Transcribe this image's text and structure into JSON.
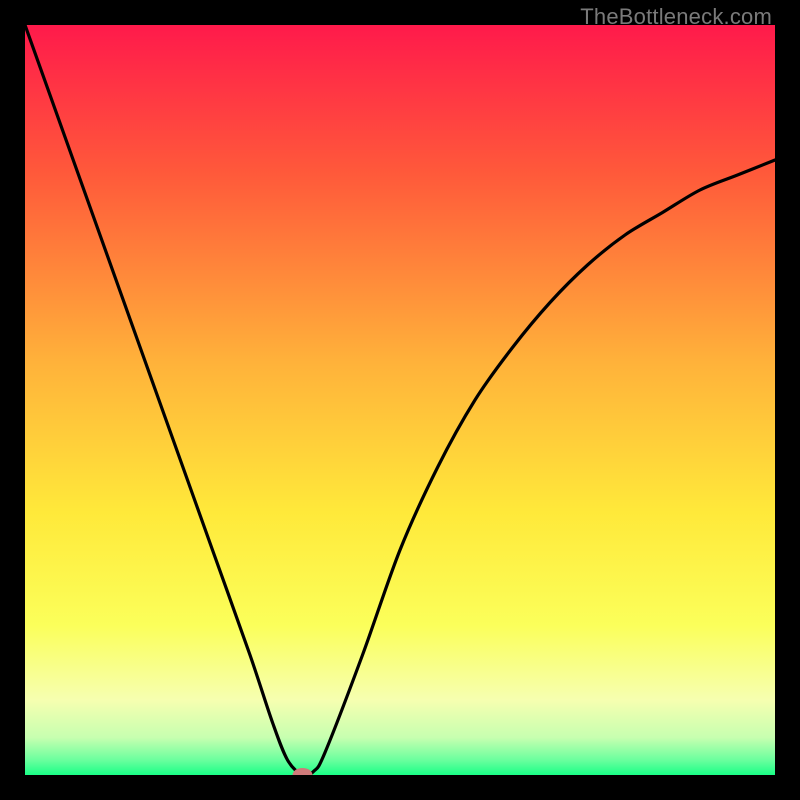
{
  "attribution": "TheBottleneck.com",
  "chart_data": {
    "type": "line",
    "title": "",
    "xlabel": "",
    "ylabel": "",
    "xlim": [
      0,
      100
    ],
    "ylim": [
      0,
      100
    ],
    "series": [
      {
        "name": "bottleneck-curve",
        "x": [
          0,
          5,
          10,
          15,
          20,
          25,
          30,
          33,
          35,
          37,
          38.5,
          40,
          45,
          50,
          55,
          60,
          65,
          70,
          75,
          80,
          85,
          90,
          95,
          100
        ],
        "y": [
          100,
          86,
          72,
          58,
          44,
          30,
          16,
          7,
          2,
          0,
          0.5,
          3,
          16,
          30,
          41,
          50,
          57,
          63,
          68,
          72,
          75,
          78,
          80,
          82
        ]
      }
    ],
    "marker": {
      "x": 37,
      "y": 0,
      "color": "#cf7a7a"
    },
    "gradient_stops": [
      {
        "offset": 0.0,
        "color": "#ff1a4b"
      },
      {
        "offset": 0.2,
        "color": "#ff5a3a"
      },
      {
        "offset": 0.45,
        "color": "#ffb23a"
      },
      {
        "offset": 0.65,
        "color": "#ffe93a"
      },
      {
        "offset": 0.8,
        "color": "#fbff5a"
      },
      {
        "offset": 0.9,
        "color": "#f6ffb0"
      },
      {
        "offset": 0.95,
        "color": "#c7ffb0"
      },
      {
        "offset": 0.98,
        "color": "#6bff9e"
      },
      {
        "offset": 1.0,
        "color": "#1aff87"
      }
    ]
  }
}
